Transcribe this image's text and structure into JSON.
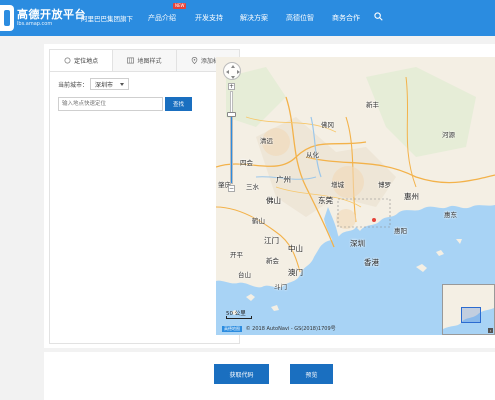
{
  "header": {
    "logo_title": "高德开放平台",
    "logo_sub": "lbs.amap.com",
    "brand_tag": "阿里巴巴集团旗下",
    "nav": [
      {
        "label": "产品介绍"
      },
      {
        "label": "开发支持"
      },
      {
        "label": "解决方案"
      },
      {
        "label": "高德位智"
      },
      {
        "label": "商务合作"
      }
    ],
    "new_badge": "NEW",
    "brand_color": "#2b8ce0"
  },
  "sidebar": {
    "tabs": [
      {
        "label": "定位地点",
        "icon": "radio-icon",
        "active": true
      },
      {
        "label": "地图样式",
        "icon": "map-style-icon",
        "active": false
      },
      {
        "label": "添加标注",
        "icon": "marker-icon",
        "active": false
      }
    ],
    "city_label": "当前城市：",
    "city_value": "深圳市",
    "search_placeholder": "输入地点快速定位",
    "search_button": "查找"
  },
  "map": {
    "labels": [
      "清远",
      "河源",
      "佛冈",
      "新丰",
      "广州",
      "增城",
      "博罗",
      "惠州",
      "东莞",
      "佛山",
      "江门",
      "中山",
      "深圳",
      "香港",
      "澳门",
      "惠东",
      "开平",
      "台山",
      "四会",
      "从化",
      "肇庆",
      "三水",
      "鹤山",
      "新会",
      "斗门",
      "惠阳"
    ],
    "scale_text": "50 公里",
    "copyright": "© 2018 AutoNavi - GS(2018)1709号",
    "logo_badge": "高德地图"
  },
  "footer": {
    "get_code_button": "获取代码",
    "preview_button": "预览"
  }
}
